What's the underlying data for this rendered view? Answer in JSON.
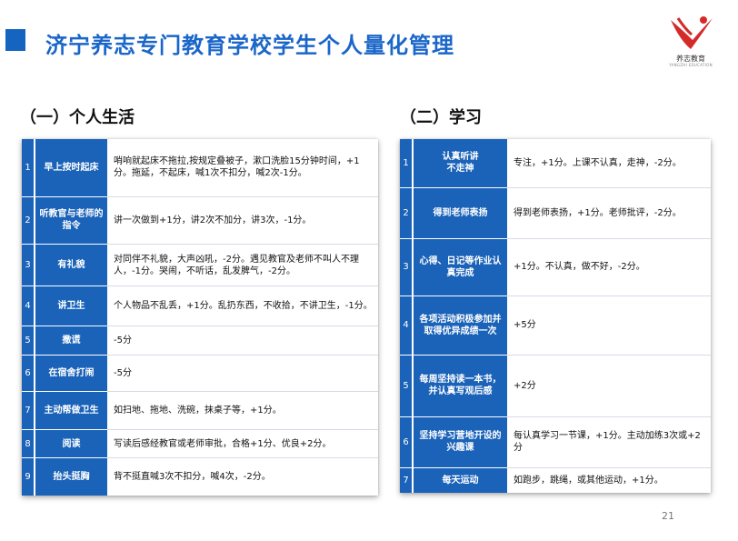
{
  "slide": {
    "title": "济宁养志专门教育学校学生个人量化管理",
    "page_number": "21"
  },
  "logo": {
    "name": "养志教育",
    "subtitle": "YANGZHI EDUCATION"
  },
  "colors": {
    "accent_blue": "#1b63b8",
    "title_blue": "#1a66c9",
    "logo_red": "#d42a2a"
  },
  "sections": [
    {
      "heading": "（一）个人生活",
      "rows": [
        {
          "num": "1",
          "item": "早上按时起床",
          "desc": "哨响就起床不拖拉,按规定叠被子，漱口洗脸15分钟时间，+1分。拖延，不起床，喊1次不扣分，喊2次-1分。"
        },
        {
          "num": "2",
          "item": "听教官与老师的指令",
          "desc": "讲一次做到+1分，讲2次不加分，讲3次，-1分。"
        },
        {
          "num": "3",
          "item": "有礼貌",
          "desc": "对同伴不礼貌，大声凶吼，-2分。遇见教官及老师不叫人不理人，-1分。哭闹，不听话，乱发脾气，-2分。"
        },
        {
          "num": "4",
          "item": "讲卫生",
          "desc": "个人物品不乱丢，+1分。乱扔东西，不收拾，不讲卫生，-1分。"
        },
        {
          "num": "5",
          "item": "撒谎",
          "desc": "-5分"
        },
        {
          "num": "6",
          "item": "在宿舍打闹",
          "desc": "-5分"
        },
        {
          "num": "7",
          "item": "主动帮做卫生",
          "desc": "如扫地、拖地、洗碗，抹桌子等，+1分。"
        },
        {
          "num": "8",
          "item": "阅读",
          "desc": "写读后感经教官或老师审批，合格+1分、优良+2分。"
        },
        {
          "num": "9",
          "item": "抬头挺胸",
          "desc": "背不挺直喊3次不扣分，喊4次，-2分。"
        }
      ]
    },
    {
      "heading": "（二）学习",
      "rows": [
        {
          "num": "1",
          "item": "认真听讲\n不走神",
          "desc": "专注，+1分。上课不认真，走神，-2分。"
        },
        {
          "num": "2",
          "item": "得到老师表扬",
          "desc": "得到老师表扬，+1分。老师批评，-2分。"
        },
        {
          "num": "3",
          "item": "心得、日记等作业认真完成",
          "desc": "+1分。不认真，做不好，-2分。"
        },
        {
          "num": "4",
          "item": "各项活动积极参加并取得优异成绩一次",
          "desc": "+5分"
        },
        {
          "num": "5",
          "item": "每周坚持读一本书，并认真写观后感",
          "desc": "+2分"
        },
        {
          "num": "6",
          "item": "坚持学习营地开设的兴趣课",
          "desc": "每认真学习一节课，+1分。主动加练3次或+2分"
        },
        {
          "num": "7",
          "item": "每天运动",
          "desc": "如跑步，跳绳，或其他运动，+1分。"
        }
      ]
    }
  ]
}
